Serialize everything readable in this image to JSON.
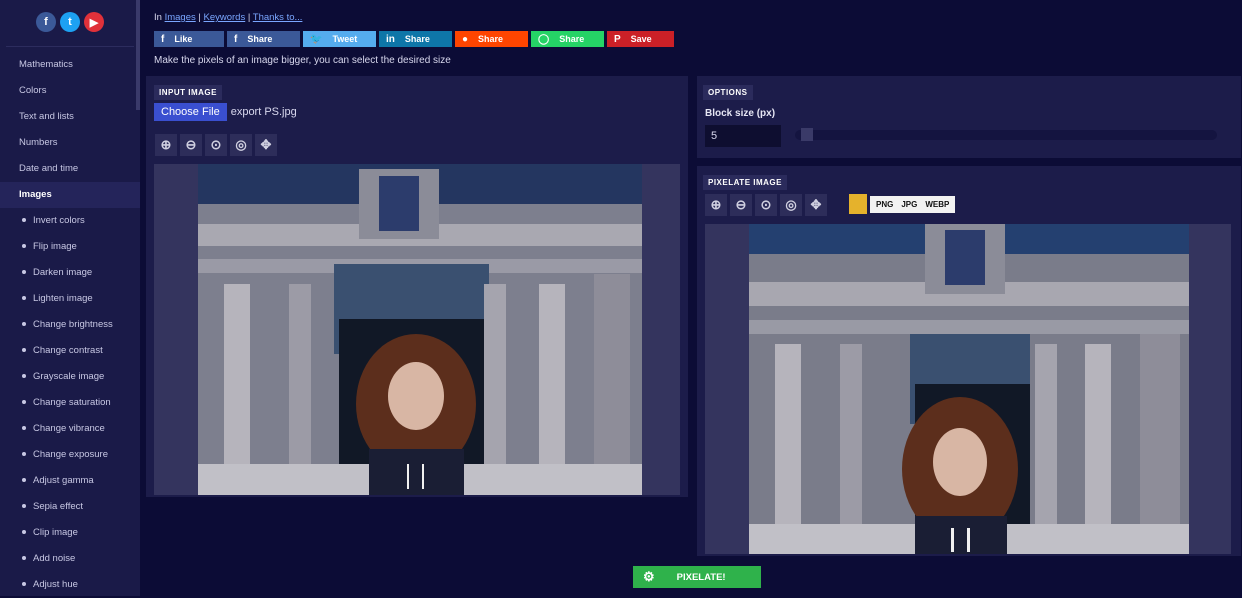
{
  "sidebar": {
    "social": [
      {
        "icon": "facebook-icon",
        "glyph": "f",
        "color": "#3b5998"
      },
      {
        "icon": "twitter-icon",
        "glyph": "t",
        "color": "#1da1f2"
      },
      {
        "icon": "youtube-icon",
        "glyph": "▶",
        "color": "#e0313a"
      }
    ],
    "categories": [
      "Mathematics",
      "Colors",
      "Text and lists",
      "Numbers",
      "Date and time",
      "Images"
    ],
    "subitems": [
      "Invert colors",
      "Flip image",
      "Darken image",
      "Lighten image",
      "Change brightness",
      "Change contrast",
      "Grayscale image",
      "Change saturation",
      "Change vibrance",
      "Change exposure",
      "Adjust gamma",
      "Sepia effect",
      "Clip image",
      "Add noise",
      "Adjust hue"
    ]
  },
  "breadcrumb": {
    "prefix": "In",
    "images": "Images",
    "sep1": "|",
    "keywords": "Keywords",
    "sep2": "|",
    "thanks": "Thanks to..."
  },
  "share": [
    {
      "label": "Like",
      "icon": "facebook-icon",
      "glyph": "f",
      "color": "#3b5998"
    },
    {
      "label": "Share",
      "icon": "facebook-icon",
      "glyph": "f",
      "color": "#3b5998"
    },
    {
      "label": "Tweet",
      "icon": "twitter-icon",
      "glyph": "🐦",
      "color": "#55acee"
    },
    {
      "label": "Share",
      "icon": "linkedin-icon",
      "glyph": "in",
      "color": "#0e76a8"
    },
    {
      "label": "Share",
      "icon": "reddit-icon",
      "glyph": "●",
      "color": "#ff4500"
    },
    {
      "label": "Share",
      "icon": "whatsapp-icon",
      "glyph": "◯",
      "color": "#25d366"
    },
    {
      "label": "Save",
      "icon": "pinterest-icon",
      "glyph": "P",
      "color": "#cb2027"
    }
  ],
  "tagline": "Make the pixels of an image bigger, you can select the desired size",
  "input_panel": {
    "title": "INPUT IMAGE",
    "choose_label": "Choose File",
    "filename": "export PS.jpg"
  },
  "options_panel": {
    "title": "OPTIONS",
    "block_size_label": "Block size (px)",
    "block_size_value": "5",
    "slider_fraction": 0.02
  },
  "output_panel": {
    "title": "PIXELATE IMAGE",
    "formats": [
      "PNG",
      "JPG",
      "WEBP"
    ]
  },
  "pixelate_button": "PIXELATE!"
}
